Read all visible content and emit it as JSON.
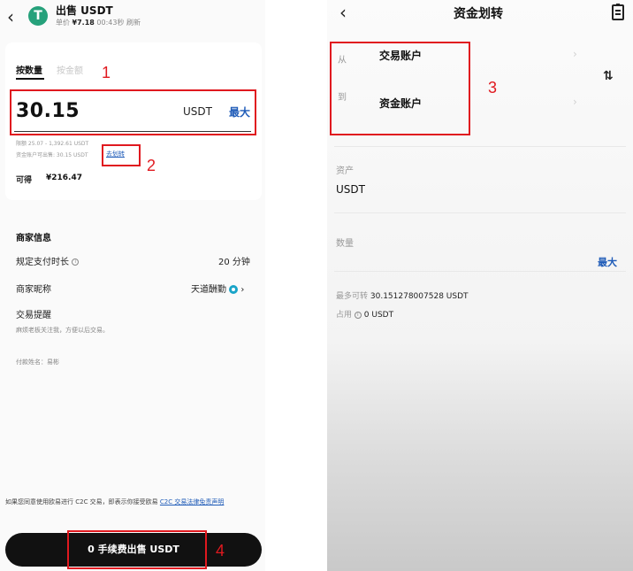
{
  "left": {
    "header": {
      "back_icon": "chevron-left-icon",
      "coin_letter": "T",
      "title": "出售 USDT",
      "price_label": "单价",
      "price_value": "¥7.18",
      "timer": "00:43秒 刷新"
    },
    "tabs": [
      {
        "label": "按数量",
        "active": true
      },
      {
        "label": "按金额",
        "active": false
      }
    ],
    "amount": "30.15",
    "unit": "USDT",
    "max_label": "最大",
    "limit_text": "限额 25.07 - 1,392.61 USDT",
    "available_text": "资金账户可出售: 30.15 USDT",
    "transfer_link": "去划转",
    "receive_label": "可得",
    "receive_value": "¥216.47",
    "merchant": {
      "section_title": "商家信息",
      "payment_time_label": "规定支付时长",
      "payment_time_value": "20 分钟",
      "nickname_label": "商家昵称",
      "nickname_value": "天道酬勤",
      "reminder_label": "交易提醒",
      "reminder_text": "麻烦老板关注我，方便以后交易。",
      "payer_name": "付款姓名：易彬"
    },
    "disclaimer_prefix": "如果您同意使用欧易进行 C2C 交易，即表示你接受欧易 ",
    "disclaimer_link": "C2C 交易法律免责声明",
    "sell_button": "0 手续费出售 USDT",
    "annotations": [
      "1",
      "2",
      "4"
    ]
  },
  "right": {
    "back_icon": "chevron-left-icon",
    "title": "资金划转",
    "record_icon": "clipboard-icon",
    "from_label": "从",
    "from_account": "交易账户",
    "to_label": "到",
    "to_account": "资金账户",
    "swap_icon": "⇅",
    "asset_label": "资产",
    "asset_value": "USDT",
    "quantity_label": "数量",
    "max_label": "最大",
    "max_transferable_label": "最多可转",
    "max_transferable_value": "30.151278007528 USDT",
    "occupied_label": "占用",
    "occupied_value": "0 USDT",
    "annotation": "3"
  },
  "colors": {
    "accent_link": "#1e5bb8",
    "annotation_red": "#e0191f",
    "usdt_green": "#26a17b",
    "button_black": "#111111"
  }
}
